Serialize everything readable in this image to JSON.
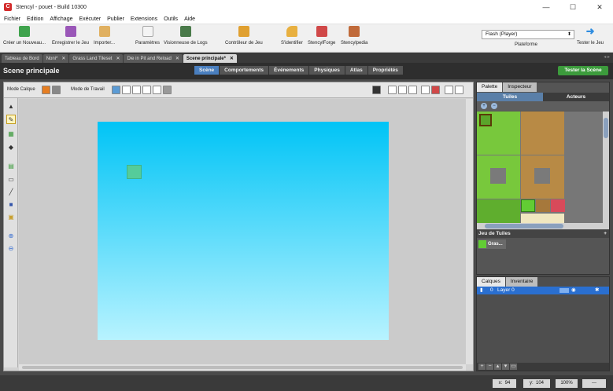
{
  "window": {
    "logo": "C",
    "title": "Stencyl - pouet - Build 10300",
    "controls": [
      "—",
      "☐",
      "✕"
    ]
  },
  "menubar": [
    "Fichier",
    "Edition",
    "Affichage",
    "Exécuter",
    "Publier",
    "Extensions",
    "Outils",
    "Aide"
  ],
  "toolbar": {
    "buttons": [
      {
        "label": "Créer un Nouveau...",
        "icon": "new-icon",
        "color": "#3fa34d"
      },
      {
        "label": "Enregistrer le Jeu",
        "icon": "save-icon",
        "color": "#9a57b8"
      },
      {
        "label": "Importer...",
        "icon": "import-icon",
        "color": "#e0b060"
      },
      {
        "label": "Paramètres",
        "icon": "settings-icon",
        "color": "#a8a8a8"
      },
      {
        "label": "Visionneuse de Logs",
        "icon": "log-viewer-icon",
        "color": "#4a7a4a"
      },
      {
        "label": "Contrôleur de Jeu",
        "icon": "game-controller-icon",
        "color": "#e0a030"
      },
      {
        "label": "S'identifier",
        "icon": "key-icon",
        "color": "#e8b040"
      },
      {
        "label": "StencylForge",
        "icon": "forge-icon",
        "color": "#d04848"
      },
      {
        "label": "Stencylpedia",
        "icon": "book-icon",
        "color": "#c06a3a"
      }
    ],
    "platform_value": "Flash (Player)",
    "platform_label": "Plateforme",
    "test_game_label": "Tester le Jeu"
  },
  "doctabs": [
    {
      "label": "Tableau de Bord",
      "closable": false
    },
    {
      "label": "Noni*",
      "closable": true
    },
    {
      "label": "Grass Land Tileset",
      "closable": true
    },
    {
      "label": "Die in Pit and Reload",
      "closable": true
    },
    {
      "label": "Scene principale*",
      "closable": true,
      "active": true
    }
  ],
  "scene": {
    "title": "Scene principale",
    "mode_tabs": [
      "Scène",
      "Comportements",
      "Événements",
      "Physiques",
      "Atlas",
      "Propriétés"
    ],
    "active_mode": "Scène",
    "test_scene_label": "Tester la Scène",
    "layer_mode_label": "Mode Calque",
    "work_mode_label": "Mode de Travail"
  },
  "right_panel": {
    "tabs": [
      "Palette",
      "Inspecteur"
    ],
    "subtabs": [
      "Tuiles",
      "Acteurs"
    ],
    "tileset_header": "Jeu de Tuiles",
    "tileset_name": "Gras..."
  },
  "layers_panel": {
    "tabs": [
      "Calques",
      "Inventaire"
    ],
    "layer_index": "0",
    "layer_name": "Layer 0"
  },
  "statusbar": {
    "x_label": "x:",
    "x_value": "94",
    "y_label": "y:",
    "y_value": "104",
    "zoom": "100%",
    "extra": "---"
  },
  "colors": {
    "scene_top": "#00c4f6",
    "scene_bottom": "#b8f3ff",
    "accent": "#4a7fbf",
    "test_button": "#3c9b3c"
  }
}
